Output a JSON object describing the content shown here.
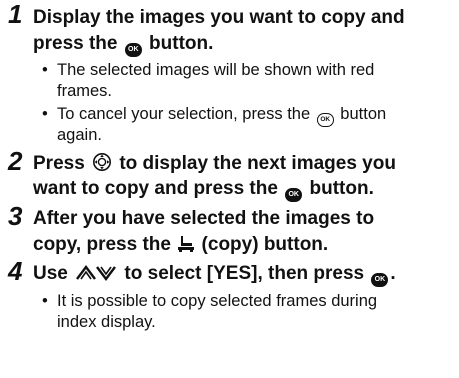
{
  "steps": [
    {
      "number": "1",
      "line1_a": "Display the images you want to copy and",
      "line2_a": "press the ",
      "line2_icon": "ok-button-icon",
      "line2_b": " button.",
      "bullets": [
        {
          "line1": "The selected images will be shown with red",
          "line2": "frames."
        },
        {
          "line1a": "To cancel your selection, press the ",
          "icon": "ok-button-icon",
          "line1b": " button",
          "line2": "again."
        }
      ]
    },
    {
      "number": "2",
      "line1_a": "Press ",
      "line1_icon": "dpad-icon",
      "line1_b": " to display the next images you",
      "line2_a": "want to copy and press the ",
      "line2_icon": "ok-button-icon",
      "line2_b": " button."
    },
    {
      "number": "3",
      "line1": "After you have selected the images to",
      "line2_a": "copy, press the ",
      "line2_icon": "copy-icon",
      "line2_b": " (copy) button."
    },
    {
      "number": "4",
      "line1_a": "Use ",
      "line1_icon": "up-down-arrows-icon",
      "line1_b": " to select [YES], then press ",
      "line1_icon2": "ok-button-icon",
      "line1_c": ".",
      "bullets": [
        {
          "line1": "It is possible to copy selected frames during",
          "line2": "index display."
        }
      ]
    }
  ],
  "bullet_char": "•",
  "icon_ok_text": "OK"
}
